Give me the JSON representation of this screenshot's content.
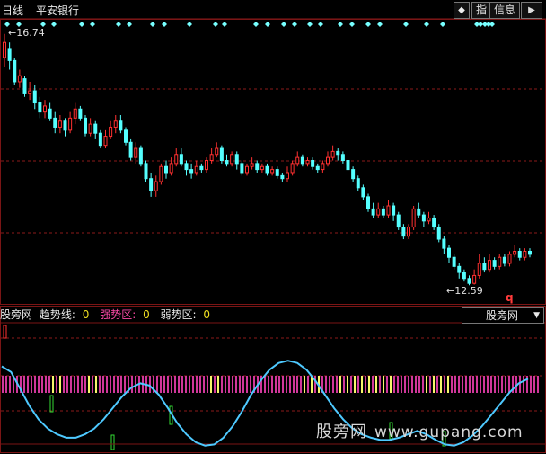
{
  "header": {
    "period": "日线",
    "stock_name": "平安银行",
    "btn_diamond": "◆",
    "btn_zhi": "指",
    "btn_info": "信息",
    "btn_arrow": "▶"
  },
  "price_chart": {
    "high_label": "16.74",
    "low_label": "12.59",
    "marker": "q"
  },
  "indicator": {
    "name": "股旁网",
    "trend_label": "趋势线:",
    "trend_value": "0",
    "strong_label": "强势区:",
    "strong_value": "0",
    "weak_label": "弱势区:",
    "weak_value": "0",
    "selected": "股旁网"
  },
  "watermark": {
    "text": "股旁网",
    "url": "www.gupang.com"
  },
  "colors": {
    "up": "#ff3030",
    "down": "#54ffff",
    "grid": "#8b1a1a",
    "line": "#4ec9ff",
    "bar_yellow": "#f5f56a",
    "bar_magenta": "#d0379a",
    "signal": "#33dd33"
  },
  "chart_data": {
    "type": "candlestick",
    "candles": [
      [
        16.35,
        16.6,
        16.74,
        16.2
      ],
      [
        16.5,
        16.3,
        16.6,
        16.15
      ],
      [
        16.3,
        15.95,
        16.35,
        15.9
      ],
      [
        15.95,
        16.05,
        16.15,
        15.85
      ],
      [
        16.0,
        15.75,
        16.05,
        15.7
      ],
      [
        15.75,
        15.8,
        15.95,
        15.65
      ],
      [
        15.8,
        15.6,
        15.9,
        15.5
      ],
      [
        15.6,
        15.45,
        15.7,
        15.35
      ],
      [
        15.45,
        15.55,
        15.65,
        15.35
      ],
      [
        15.5,
        15.35,
        15.6,
        15.3
      ],
      [
        15.35,
        15.2,
        15.45,
        15.1
      ],
      [
        15.2,
        15.3,
        15.4,
        15.1
      ],
      [
        15.3,
        15.15,
        15.35,
        15.05
      ],
      [
        15.15,
        15.35,
        15.45,
        15.1
      ],
      [
        15.35,
        15.5,
        15.6,
        15.25
      ],
      [
        15.5,
        15.35,
        15.55,
        15.3
      ],
      [
        15.35,
        15.1,
        15.4,
        15.05
      ],
      [
        15.1,
        15.25,
        15.35,
        15.05
      ],
      [
        15.25,
        15.1,
        15.3,
        15.0
      ],
      [
        15.1,
        14.9,
        15.15,
        14.85
      ],
      [
        14.9,
        15.05,
        15.15,
        14.85
      ],
      [
        15.05,
        15.2,
        15.3,
        15.0
      ],
      [
        15.2,
        15.3,
        15.4,
        15.1
      ],
      [
        15.3,
        15.15,
        15.4,
        15.1
      ],
      [
        15.15,
        14.95,
        15.2,
        14.9
      ],
      [
        14.95,
        14.7,
        15.0,
        14.65
      ],
      [
        14.7,
        14.85,
        14.95,
        14.6
      ],
      [
        14.85,
        14.6,
        14.9,
        14.55
      ],
      [
        14.6,
        14.35,
        14.65,
        14.3
      ],
      [
        14.35,
        14.15,
        14.45,
        14.05
      ],
      [
        14.15,
        14.3,
        14.4,
        14.05
      ],
      [
        14.3,
        14.55,
        14.6,
        14.25
      ],
      [
        14.55,
        14.45,
        14.65,
        14.35
      ],
      [
        14.45,
        14.6,
        14.7,
        14.4
      ],
      [
        14.6,
        14.75,
        14.85,
        14.55
      ],
      [
        14.75,
        14.6,
        14.85,
        14.55
      ],
      [
        14.6,
        14.5,
        14.65,
        14.4
      ],
      [
        14.5,
        14.45,
        14.6,
        14.35
      ],
      [
        14.45,
        14.55,
        14.65,
        14.4
      ],
      [
        14.55,
        14.5,
        14.6,
        14.45
      ],
      [
        14.5,
        14.65,
        14.7,
        14.45
      ],
      [
        14.65,
        14.75,
        14.85,
        14.6
      ],
      [
        14.75,
        14.85,
        14.95,
        14.7
      ],
      [
        14.85,
        14.65,
        14.9,
        14.6
      ],
      [
        14.65,
        14.6,
        14.75,
        14.55
      ],
      [
        14.6,
        14.75,
        14.8,
        14.55
      ],
      [
        14.75,
        14.6,
        14.8,
        14.5
      ],
      [
        14.6,
        14.45,
        14.65,
        14.4
      ],
      [
        14.45,
        14.55,
        14.6,
        14.4
      ],
      [
        14.55,
        14.6,
        14.7,
        14.5
      ],
      [
        14.6,
        14.5,
        14.65,
        14.45
      ],
      [
        14.5,
        14.55,
        14.6,
        14.45
      ],
      [
        14.55,
        14.45,
        14.6,
        14.4
      ],
      [
        14.45,
        14.5,
        14.55,
        14.4
      ],
      [
        14.5,
        14.4,
        14.55,
        14.35
      ],
      [
        14.4,
        14.35,
        14.45,
        14.3
      ],
      [
        14.35,
        14.45,
        14.55,
        14.3
      ],
      [
        14.45,
        14.6,
        14.65,
        14.4
      ],
      [
        14.6,
        14.7,
        14.8,
        14.55
      ],
      [
        14.7,
        14.6,
        14.75,
        14.55
      ],
      [
        14.6,
        14.65,
        14.7,
        14.55
      ],
      [
        14.65,
        14.55,
        14.7,
        14.5
      ],
      [
        14.55,
        14.5,
        14.6,
        14.45
      ],
      [
        14.5,
        14.6,
        14.65,
        14.45
      ],
      [
        14.6,
        14.7,
        14.8,
        14.55
      ],
      [
        14.7,
        14.8,
        14.9,
        14.65
      ],
      [
        14.8,
        14.75,
        14.85,
        14.65
      ],
      [
        14.75,
        14.65,
        14.8,
        14.6
      ],
      [
        14.65,
        14.5,
        14.7,
        14.45
      ],
      [
        14.5,
        14.35,
        14.55,
        14.3
      ],
      [
        14.35,
        14.2,
        14.4,
        14.15
      ],
      [
        14.2,
        14.05,
        14.25,
        14.0
      ],
      [
        14.05,
        13.85,
        14.1,
        13.8
      ],
      [
        13.85,
        13.75,
        13.95,
        13.7
      ],
      [
        13.75,
        13.85,
        13.95,
        13.7
      ],
      [
        13.85,
        13.75,
        13.9,
        13.7
      ],
      [
        13.75,
        13.9,
        14.0,
        13.7
      ],
      [
        13.9,
        13.75,
        13.95,
        13.65
      ],
      [
        13.75,
        13.55,
        13.8,
        13.5
      ],
      [
        13.55,
        13.4,
        13.6,
        13.35
      ],
      [
        13.4,
        13.55,
        13.6,
        13.35
      ],
      [
        13.55,
        13.85,
        13.9,
        13.5
      ],
      [
        13.85,
        13.75,
        13.95,
        13.7
      ],
      [
        13.75,
        13.65,
        13.8,
        13.55
      ],
      [
        13.65,
        13.7,
        13.8,
        13.6
      ],
      [
        13.7,
        13.55,
        13.75,
        13.5
      ],
      [
        13.55,
        13.35,
        13.6,
        13.3
      ],
      [
        13.35,
        13.2,
        13.4,
        13.1
      ],
      [
        13.2,
        13.05,
        13.25,
        12.95
      ],
      [
        13.05,
        12.9,
        13.1,
        12.85
      ],
      [
        12.9,
        12.8,
        12.95,
        12.7
      ],
      [
        12.8,
        12.7,
        12.85,
        12.65
      ],
      [
        12.7,
        12.62,
        12.75,
        12.59
      ],
      [
        12.62,
        12.75,
        12.85,
        12.6
      ],
      [
        12.75,
        12.95,
        13.1,
        12.7
      ],
      [
        12.95,
        12.85,
        13.05,
        12.8
      ],
      [
        12.85,
        13.0,
        13.1,
        12.8
      ],
      [
        13.0,
        12.9,
        13.05,
        12.85
      ],
      [
        12.9,
        13.05,
        13.1,
        12.85
      ],
      [
        13.05,
        12.95,
        13.1,
        12.9
      ],
      [
        12.95,
        13.1,
        13.15,
        12.9
      ],
      [
        13.1,
        13.15,
        13.25,
        13.05
      ],
      [
        13.15,
        13.05,
        13.2,
        13.0
      ],
      [
        13.05,
        13.15,
        13.2,
        13.0
      ],
      [
        13.15,
        13.1,
        13.2,
        13.05
      ]
    ],
    "indicator_line": [
      0.75,
      0.7,
      0.55,
      0.4,
      0.28,
      0.2,
      0.15,
      0.12,
      0.12,
      0.15,
      0.2,
      0.28,
      0.38,
      0.48,
      0.56,
      0.6,
      0.58,
      0.5,
      0.38,
      0.25,
      0.15,
      0.08,
      0.05,
      0.06,
      0.12,
      0.22,
      0.35,
      0.5,
      0.62,
      0.72,
      0.78,
      0.8,
      0.78,
      0.72,
      0.62,
      0.5,
      0.38,
      0.28,
      0.2,
      0.15,
      0.12,
      0.1,
      0.1,
      0.12,
      0.15,
      0.18,
      0.15,
      0.1,
      0.06,
      0.05,
      0.08,
      0.14,
      0.22,
      0.32,
      0.42,
      0.52,
      0.6,
      0.64
    ],
    "ylim": [
      12.4,
      16.9
    ]
  }
}
